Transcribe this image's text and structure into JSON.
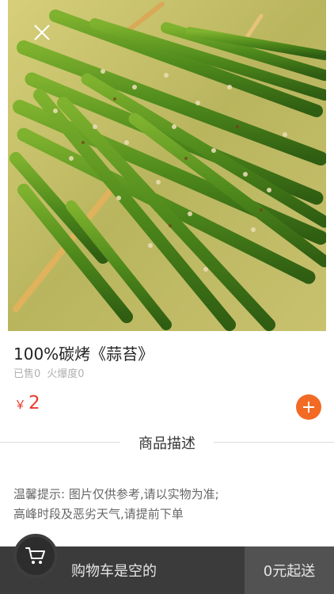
{
  "product": {
    "title": "100%碳烤《蒜苔》",
    "sold": "已售0",
    "popularity": "火爆度0",
    "currency": "￥",
    "price": "2"
  },
  "description": {
    "heading": "商品描述",
    "tip_line1": "温馨提示: 图片仅供参考,请以实物为准;",
    "tip_line2": "高峰时段及恶劣天气,请提前下单"
  },
  "cart": {
    "empty_label": "购物车是空的",
    "min_order_label": "0元起送"
  },
  "colors": {
    "price": "#e8382a",
    "accent": "#f26a24",
    "cart_bar": "#3b3b3b"
  },
  "icons": {
    "close": "close-icon",
    "add": "plus-icon",
    "cart": "cart-icon"
  }
}
